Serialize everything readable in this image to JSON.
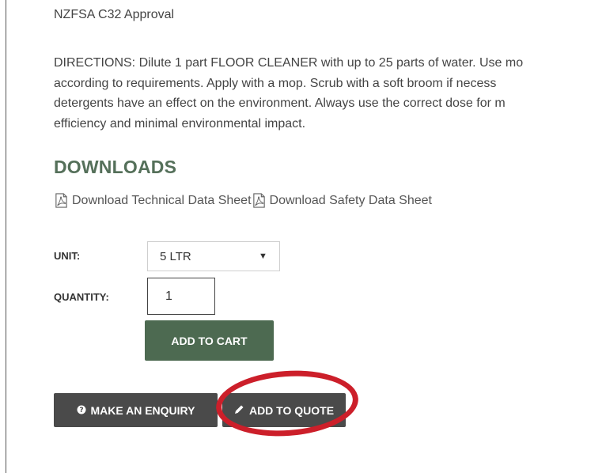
{
  "product": {
    "approval": "NZFSA C32 Approval",
    "directions_lines": [
      "DIRECTIONS: Dilute 1 part FLOOR CLEANER with up to 25 parts of water. Use mo",
      "according to requirements. Apply with a mop. Scrub with a soft broom if necess",
      "detergents have an effect on the environment. Always use the correct dose for m",
      "efficiency and minimal environmental impact."
    ]
  },
  "downloads": {
    "title": "DOWNLOADS",
    "technical_label": "Download Technical Data Sheet",
    "safety_label": "Download Safety Data Sheet",
    "icon": "pdf-icon"
  },
  "form": {
    "unit_label": "UNIT:",
    "unit_value": "5 LTR",
    "quantity_label": "QUANTITY:",
    "quantity_value": "1",
    "add_to_cart": "ADD TO CART"
  },
  "actions": {
    "enquiry_label": "MAKE AN ENQUIRY",
    "enquiry_icon": "question-circle-icon",
    "quote_label": "ADD TO QUOTE",
    "quote_icon": "pencil-icon"
  },
  "colors": {
    "accent_green": "#4d6a51",
    "heading_green": "#55705a",
    "dark_button": "#4a4a4a",
    "highlight_red": "#cc1f2a"
  }
}
